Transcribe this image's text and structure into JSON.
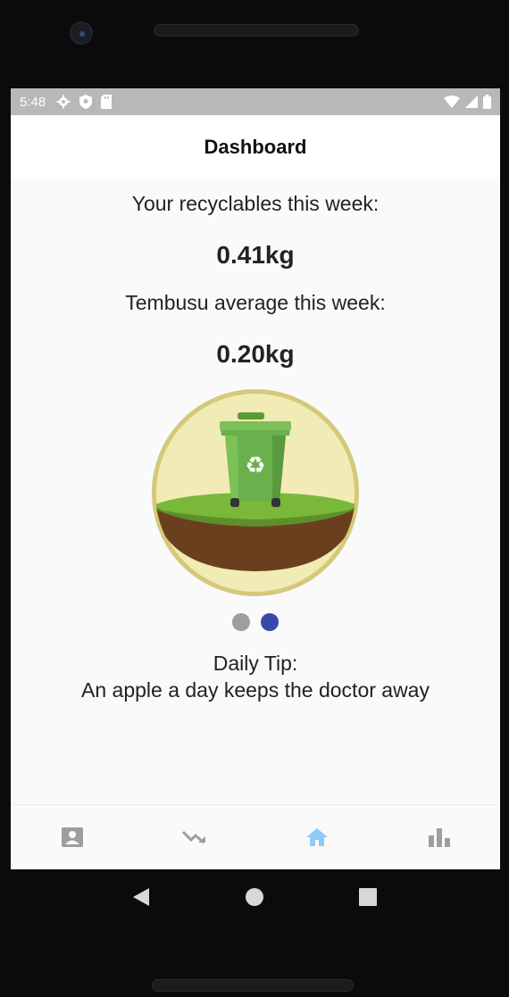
{
  "status_bar": {
    "time": "5:48",
    "left_icons": [
      "settings-icon",
      "shield-icon",
      "sd-card-icon"
    ],
    "right_icons": [
      "wifi-icon",
      "signal-icon",
      "battery-icon"
    ]
  },
  "app_bar": {
    "title": "Dashboard"
  },
  "dashboard": {
    "your_label": "Your recyclables this week:",
    "your_value": "0.41kg",
    "avg_label": "Tembusu average this week:",
    "avg_value": "0.20kg",
    "illustration": "recycling-bin-on-earth",
    "carousel": {
      "count": 2,
      "active_index": 1
    },
    "tip_title": "Daily Tip:",
    "tip_text": "An apple a day keeps the doctor away"
  },
  "bottom_nav": {
    "items": [
      {
        "icon": "profile-card-icon",
        "active": false
      },
      {
        "icon": "trending-down-icon",
        "active": false
      },
      {
        "icon": "home-icon",
        "active": true
      },
      {
        "icon": "bar-chart-icon",
        "active": false
      }
    ],
    "active_color": "#90caf9",
    "inactive_color": "#9e9e9e"
  },
  "system_nav": [
    "back-icon",
    "home-circle-icon",
    "recents-icon"
  ],
  "colors": {
    "status_bar": "#b8b8b8",
    "dot_inactive": "#9e9e9e",
    "dot_active": "#3949ab",
    "badge_ring": "#d4c97a",
    "badge_fill": "#f1ebb5",
    "bin_green": "#6ab04c",
    "soil": "#6b3f1d"
  }
}
